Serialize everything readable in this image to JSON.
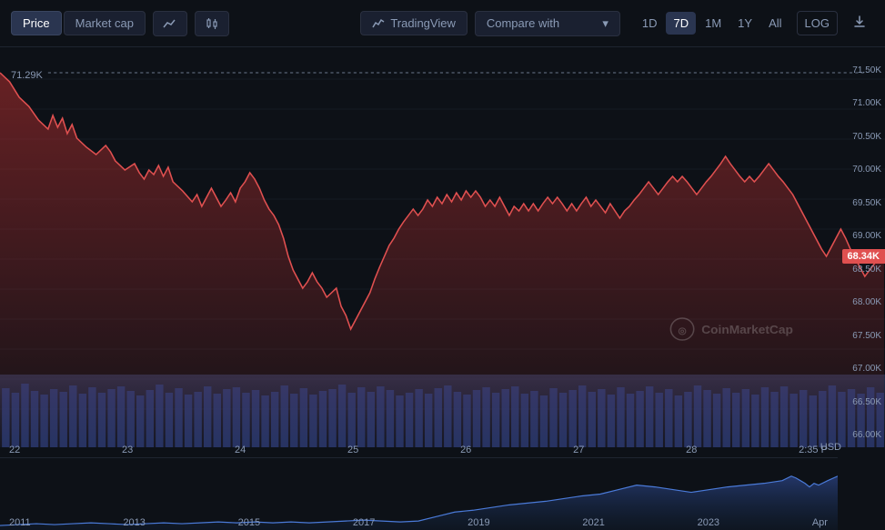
{
  "toolbar": {
    "price_label": "Price",
    "market_cap_label": "Market cap",
    "tradingview_label": "TradingView",
    "compare_label": "Compare with",
    "timeframes": [
      "1D",
      "7D",
      "1M",
      "1Y",
      "All"
    ],
    "active_timeframe": "7D",
    "log_label": "LOG",
    "download_icon": "⬇"
  },
  "chart": {
    "max_price": "71.29K",
    "current_price": "68.34K",
    "currency": "USD",
    "watermark": "CoinMarketCap",
    "x_labels": [
      "22",
      "23",
      "24",
      "25",
      "26",
      "27",
      "28",
      "2:35 P"
    ],
    "y_labels": [
      "71.50K",
      "71.00K",
      "70.50K",
      "70.00K",
      "69.50K",
      "69.00K",
      "68.50K",
      "68.00K",
      "67.50K",
      "67.00K",
      "66.50K",
      "66.00K"
    ],
    "mini_x_labels": [
      "2011",
      "2013",
      "2015",
      "2017",
      "2019",
      "2021",
      "2023",
      "Apr"
    ]
  }
}
